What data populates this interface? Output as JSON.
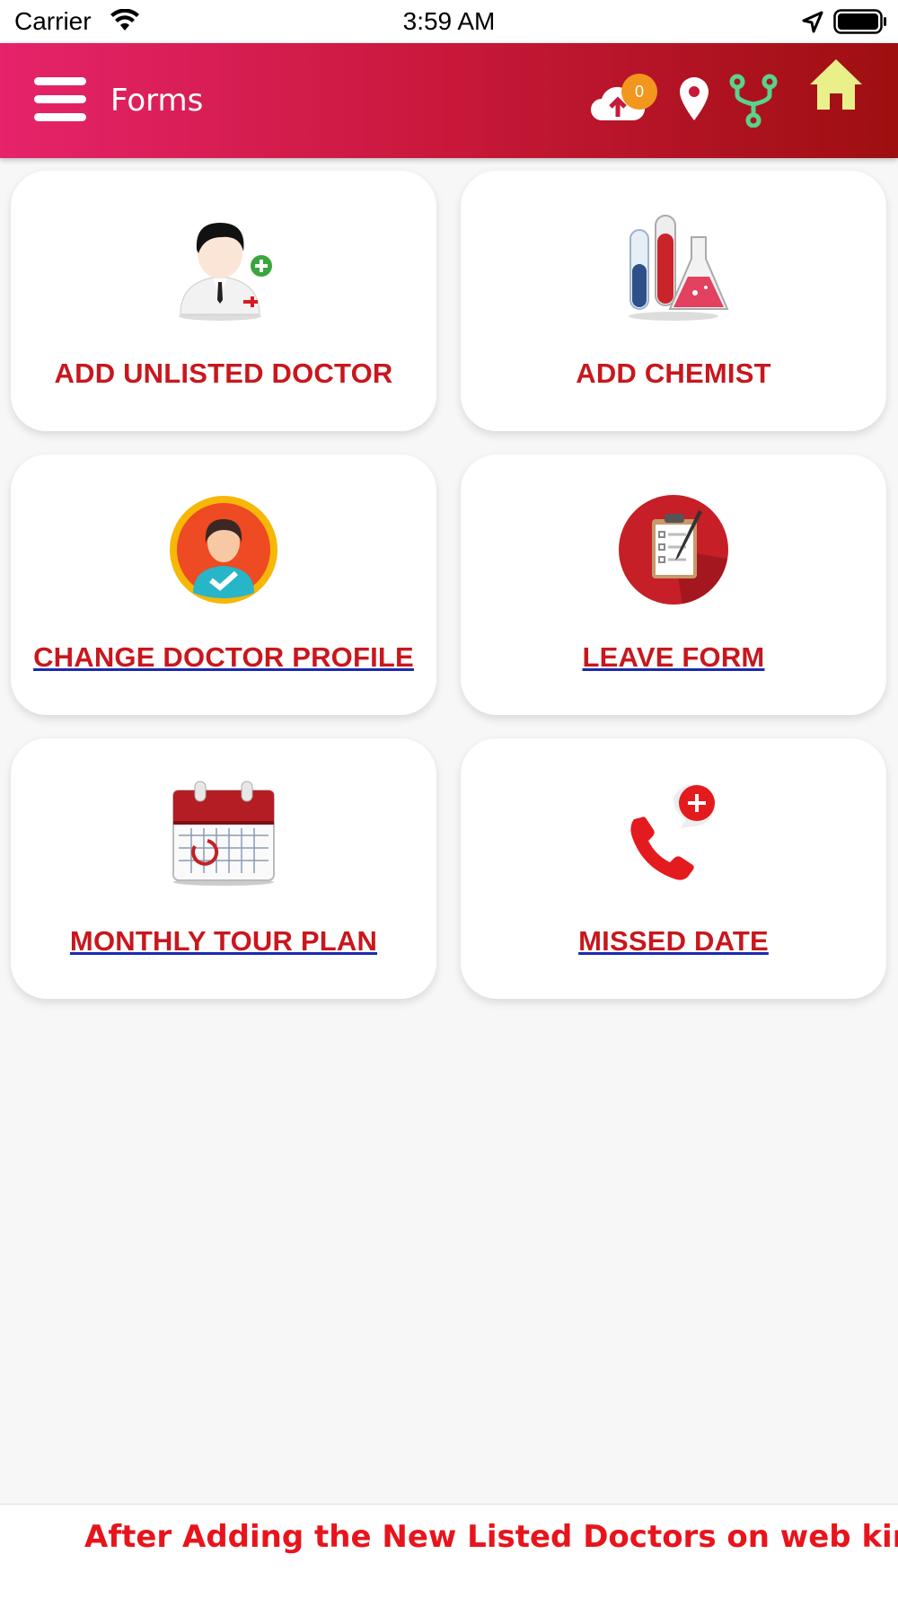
{
  "status_bar": {
    "carrier": "Carrier",
    "time": "3:59 AM"
  },
  "header": {
    "title": "Forms",
    "sync_badge": "0",
    "colors": {
      "gradient_start": "#e6236b",
      "gradient_end": "#9e0f10",
      "badge": "#f3961d",
      "tree_icon": "#59d38c",
      "home_icon": "#e9f08a"
    },
    "icons": [
      "menu-icon",
      "cloud-upload-icon",
      "location-pin-icon",
      "branch-tree-icon",
      "home-icon"
    ]
  },
  "cards": [
    {
      "label": "ADD UNLISTED DOCTOR",
      "icon": "doctor-add-icon"
    },
    {
      "label": "ADD CHEMIST",
      "icon": "test-tubes-flask-icon"
    },
    {
      "label": "CHANGE DOCTOR PROFILE",
      "icon": "profile-check-icon"
    },
    {
      "label": "LEAVE FORM",
      "icon": "clipboard-icon"
    },
    {
      "label": "MONTHLY TOUR PLAN",
      "icon": "calendar-icon"
    },
    {
      "label": "MISSED DATE",
      "icon": "missed-call-icon"
    }
  ],
  "footer": {
    "marquee": "After Adding the New Listed Doctors on web kindly c"
  },
  "accent_color": "#c8171d"
}
